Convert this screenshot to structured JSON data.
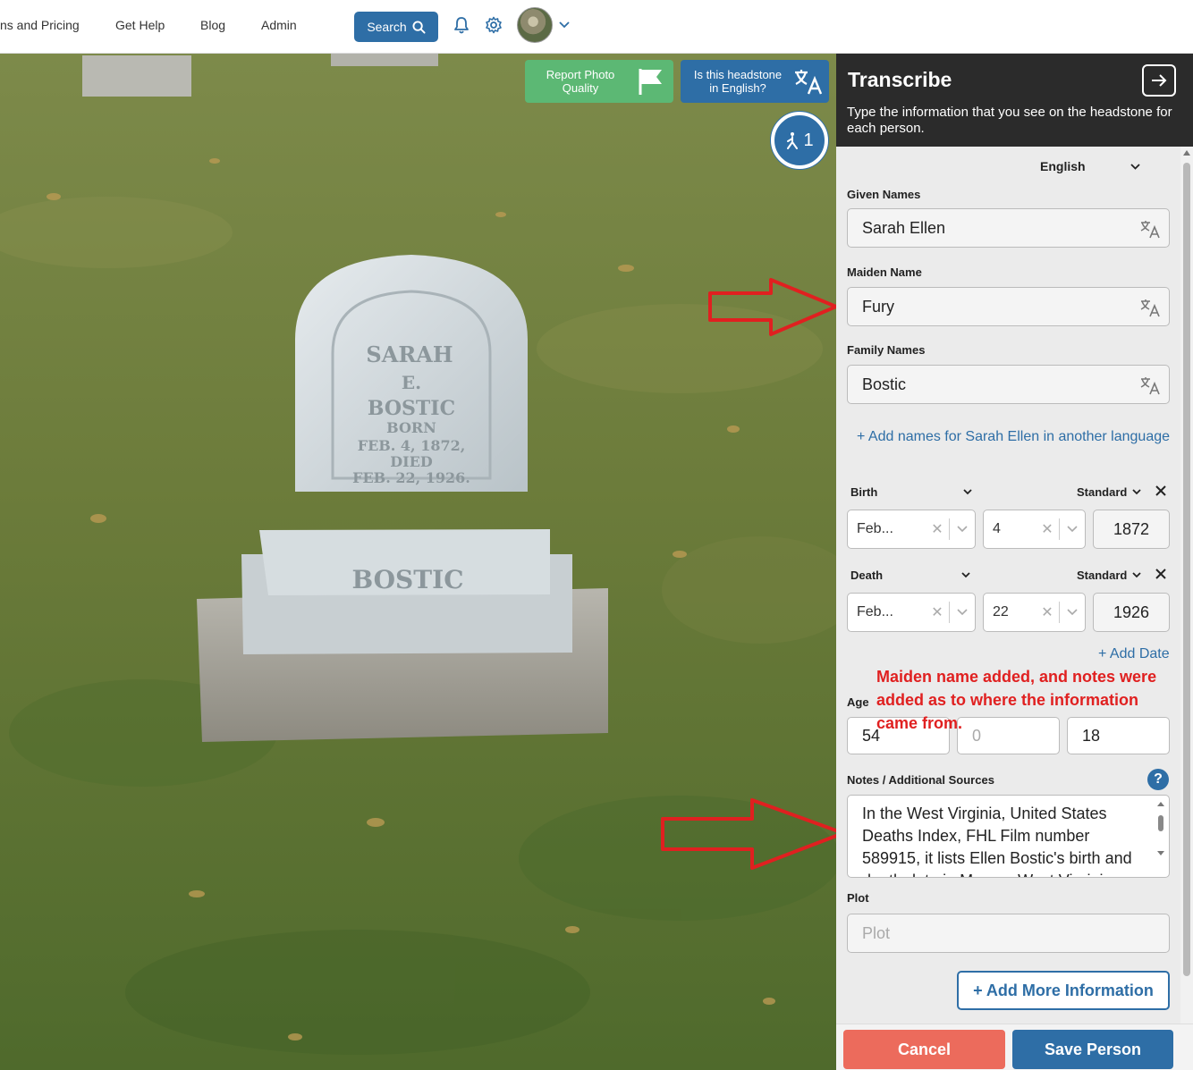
{
  "nav": {
    "links": [
      "ns and Pricing",
      "Get Help",
      "Blog",
      "Admin"
    ],
    "search_label": "Search"
  },
  "photo": {
    "report_quality_label": "Report Photo Quality",
    "english_question_label": "Is this headstone in English?",
    "person_count": "1",
    "headstone_inscription": [
      "SARAH",
      "E.",
      "BOSTIC",
      "BORN",
      "FEB. 4, 1872,",
      "DIED",
      "FEB. 22, 1926."
    ],
    "headstone_base": "BOSTIC"
  },
  "annotation": {
    "text": "Maiden name added, and notes were added as to where the information came from.",
    "color": "#e02020"
  },
  "panel": {
    "title": "Transcribe",
    "description": "Type the information that you see on the headstone for each person.",
    "language": "English",
    "given_names_label": "Given Names",
    "given_names_value": "Sarah Ellen",
    "maiden_name_label": "Maiden Name",
    "maiden_name_value": "Fury",
    "family_names_label": "Family Names",
    "family_names_value": "Bostic",
    "add_names_link": "+ Add names for Sarah Ellen in another language",
    "birth": {
      "label": "Birth",
      "calendar": "Standard",
      "month": "Feb...",
      "day": "4",
      "year": "1872"
    },
    "death": {
      "label": "Death",
      "calendar": "Standard",
      "month": "Feb...",
      "day": "22",
      "year": "1926"
    },
    "add_date_link": "+ Add Date",
    "age": {
      "label": "Age",
      "years": "54",
      "months": "0",
      "days": "18"
    },
    "notes_label": "Notes / Additional Sources",
    "notes_value": "In the West Virginia, United States Deaths Index, FHL Film number 589915, it lists Ellen Bostic's birth and death date in Mercer, West Virginia.",
    "plot_label": "Plot",
    "plot_placeholder": "Plot",
    "add_more_label": "+ Add More Information",
    "cancel_label": "Cancel",
    "save_label": "Save Person"
  },
  "colors": {
    "brand_blue": "#2e6ea6",
    "report_green": "#5cb874",
    "cancel_red": "#ec6b5c",
    "header_dark": "#2b2b2b"
  }
}
